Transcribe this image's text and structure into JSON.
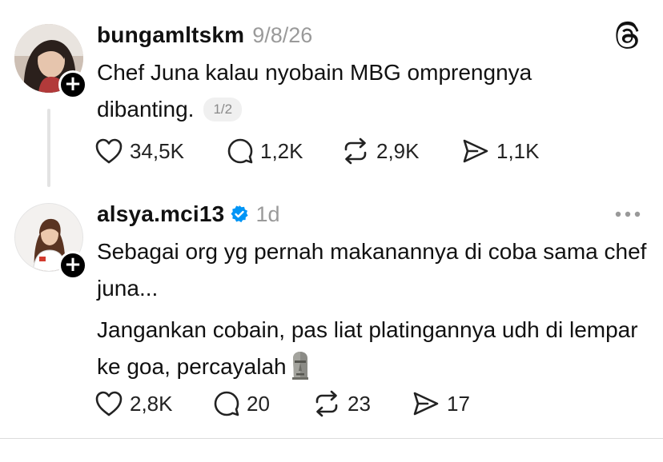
{
  "post1": {
    "username": "bungamltskm",
    "timestamp": "9/8/26",
    "text": "Chef Juna kalau nyobain MBG omprengnya dibanting.",
    "page_badge": "1/2",
    "likes": "34,5K",
    "replies": "1,2K",
    "reposts": "2,9K",
    "shares": "1,1K"
  },
  "post2": {
    "username": "alsya.mci13",
    "timestamp": "1d",
    "para1": "Sebagai org yg pernah makanannya di coba sama chef juna...",
    "para2": "Jangankan cobain, pas liat platingannya udh di lempar ke goa, percayalah",
    "likes": "2,8K",
    "replies": "20",
    "reposts": "23",
    "shares": "17"
  },
  "icons": {
    "app_logo": "threads-logo-icon",
    "follow": "plus-icon",
    "verified": "verified-badge-icon",
    "more": "more-options-icon",
    "like": "heart-icon",
    "reply": "speech-bubble-icon",
    "repost": "repost-icon",
    "share": "send-icon",
    "emoji": "moai-emoji"
  },
  "colors": {
    "text": "#111111",
    "muted": "#9a9a9a",
    "verified": "#0095f6",
    "badge_bg": "#f0f0f0"
  }
}
